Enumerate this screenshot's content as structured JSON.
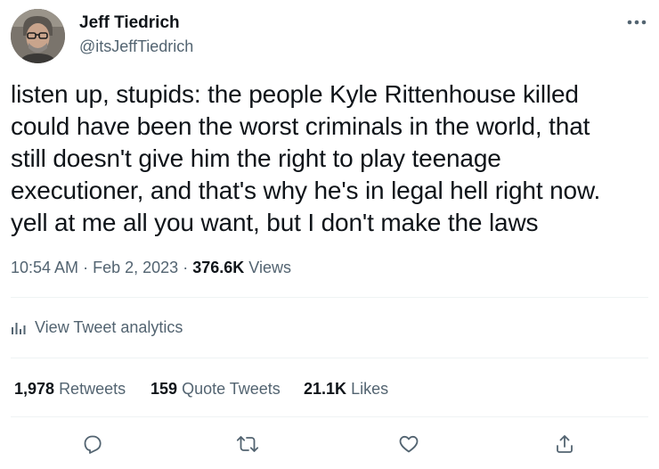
{
  "author": {
    "display_name": "Jeff Tiedrich",
    "handle": "@itsJeffTiedrich"
  },
  "tweet": {
    "text": "listen up, stupids: the people Kyle Rittenhouse killed\ncould have been the worst criminals in the world, that\nstill doesn't give him the right to play teenage\nexecutioner, and that's why he's in legal hell right now.\nyell at me all you want, but I don't make the laws",
    "time": "10:54 AM",
    "date": "Feb 2, 2023",
    "separator": "·",
    "views_count": "376.6K",
    "views_label": "Views"
  },
  "analytics": {
    "label": "View Tweet analytics",
    "icon": "bar-chart-icon"
  },
  "stats": {
    "retweets_count": "1,978",
    "retweets_label": "Retweets",
    "quotes_count": "159",
    "quotes_label": "Quote Tweets",
    "likes_count": "21.1K",
    "likes_label": "Likes"
  },
  "actions": {
    "icons": [
      "reply-icon",
      "retweet-icon",
      "like-icon",
      "share-icon"
    ]
  },
  "colors": {
    "text": "#0f1419",
    "secondary": "#536471",
    "divider": "#eff3f4"
  }
}
